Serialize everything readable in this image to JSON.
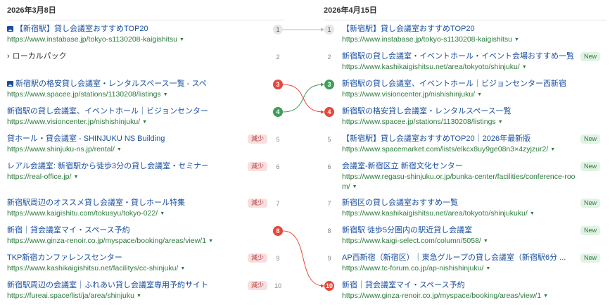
{
  "left": {
    "date": "2026年3月8日",
    "rows": [
      {
        "icon": "image",
        "title": "【新宿駅】貸し会議室おすすめTOP20",
        "url": "https://www.instabase.jp/tokyo-s1130208-kaigishitsu",
        "rank": "1",
        "rank_style": "grey",
        "badge": ""
      },
      {
        "icon": "chevron",
        "title": "ローカルパック",
        "url": "",
        "rank": "2",
        "rank_style": "plain",
        "badge": ""
      },
      {
        "icon": "image",
        "title": "新宿駅の格安貸し会議室・レンタルスペース一覧 - スペイシー",
        "url": "https://www.spacee.jp/stations/1130208/listings",
        "rank": "3",
        "rank_style": "red",
        "badge": ""
      },
      {
        "icon": "",
        "title": "新宿駅の貸し会議室、イベントホール｜ビジョンセンター西新宿",
        "url": "https://www.visioncenter.jp/nishishinjuku/",
        "rank": "4",
        "rank_style": "green",
        "badge": ""
      },
      {
        "icon": "",
        "title": "貸ホール・貸会議室 - SHINJUKU NS Building",
        "url": "https://www.shinjuku-ns.jp/rental/",
        "rank": "5",
        "rank_style": "plain",
        "badge": "減少"
      },
      {
        "icon": "",
        "title": "レアル会議室: 新宿駅から徒歩3分の貸し会議室・セミナー ...",
        "url": "https://real-office.jp/",
        "rank": "6",
        "rank_style": "plain",
        "badge": "減少"
      },
      {
        "icon": "",
        "title": "新宿駅周辺のオススメ貸し会議室・貸しホール特集",
        "url": "https://www.kaigishitu.com/tokusyu/tokyo-022/",
        "rank": "7",
        "rank_style": "plain",
        "badge": "減少"
      },
      {
        "icon": "",
        "title": "新宿｜貸会議室マイ・スペース予約",
        "url": "https://www.ginza-renoir.co.jp/myspace/booking/areas/view/1",
        "rank": "8",
        "rank_style": "red",
        "badge": ""
      },
      {
        "icon": "",
        "title": "TKP新宿カンファレンスセンター",
        "url": "https://www.kashikaigishitsu.net/facilitys/cc-shinjuku/",
        "rank": "9",
        "rank_style": "plain",
        "badge": "減少"
      },
      {
        "icon": "",
        "title": "新宿駅周辺の会議室｜ふれあい貸し会議室専用予約サイト",
        "url": "https://fureai.space/list/ja/area/shinjuku",
        "rank": "10",
        "rank_style": "plain",
        "badge": "減少"
      }
    ]
  },
  "right": {
    "date": "2026年4月15日",
    "rows": [
      {
        "rank": "1",
        "rank_style": "grey",
        "title": "【新宿駅】貸し会議室おすすめTOP20",
        "url": "https://www.instabase.jp/tokyo-s1130208-kaigishitsu",
        "badge": ""
      },
      {
        "rank": "2",
        "rank_style": "plain",
        "title": "新宿駅の貸し会議室・イベントホール・イベント会場おすすめ一覧",
        "url": "https://www.kashikaigishitsu.net/area/tokyoto/shinjuku/",
        "badge": "New"
      },
      {
        "rank": "3",
        "rank_style": "green",
        "title": "新宿駅の貸し会議室、イベントホール｜ビジョンセンター西新宿",
        "url": "https://www.visioncenter.jp/nishishinjuku/",
        "badge": ""
      },
      {
        "rank": "4",
        "rank_style": "red",
        "title": "新宿駅の格安貸し会議室・レンタルスペース一覧",
        "url": "https://www.spacee.jp/stations/1130208/listings",
        "badge": ""
      },
      {
        "rank": "5",
        "rank_style": "plain",
        "title": "【新宿駅】貸し会議室おすすめTOP20｜2026年最新版",
        "url": "https://www.spacemarket.com/lists/elkcx8uy9ge08n3×4zyjzur2/",
        "badge": "New"
      },
      {
        "rank": "6",
        "rank_style": "plain",
        "title": "会議室-新宿区立 新宿文化センター",
        "url": "https://www.regasu-shinjuku.or.jp/bunka-center/facilities/conference-room/",
        "url_line1": "https://www.regasu-shinjuku.or.jp/bunka-center/facilities/conference-roo",
        "url_line2": "m/",
        "badge": "New"
      },
      {
        "rank": "7",
        "rank_style": "plain",
        "title": "新宿区の貸し会議室おすすめ一覧",
        "url": "https://www.kashikaigishitsu.net/area/tokyoto/shinjukuku/",
        "badge": "New"
      },
      {
        "rank": "8",
        "rank_style": "plain",
        "title": "新宿駅 徒歩5分圏内の駅近貸し会議室",
        "url": "https://www.kaigi-select.com/column/5058/",
        "badge": "New"
      },
      {
        "rank": "9",
        "rank_style": "plain",
        "title": "AP西新宿（新宿区）｜東急グループの貸し会議室（新宿駅6分 ...",
        "url": "https://www.tc-forum.co.jp/ap-nishishinjuku/",
        "badge": "New"
      },
      {
        "rank": "10",
        "rank_style": "red",
        "title": "新宿｜貸会議室マイ・スペース予約",
        "url": "https://www.ginza-renoir.co.jp/myspace/booking/areas/view/1",
        "badge": ""
      }
    ]
  },
  "colors": {
    "link": "#1a4fa0",
    "url": "#2c7a3d",
    "rank_up": "#3f9d5a",
    "rank_down": "#e5473a",
    "badge_down_bg": "#f8dede",
    "badge_new_bg": "#e2f2e4",
    "connector_neutral": "#b8b8b8"
  }
}
